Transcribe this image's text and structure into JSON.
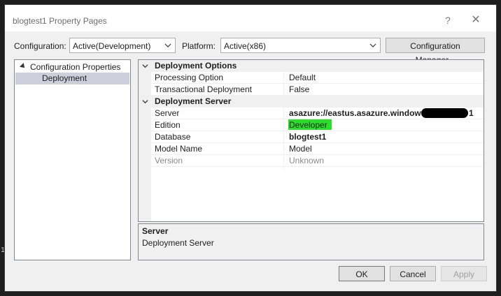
{
  "side_marker": "1",
  "window": {
    "title": "blogtest1 Property Pages",
    "help_glyph": "?",
    "close_glyph": "✕"
  },
  "toolbar": {
    "configuration_label": "Configuration:",
    "configuration_value": "Active(Development)",
    "platform_label": "Platform:",
    "platform_value": "Active(x86)",
    "config_manager_label": "Configuration Manager..."
  },
  "tree": {
    "root_label": "Configuration Properties",
    "child_label": "Deployment"
  },
  "grid": {
    "categories": [
      {
        "label": "Deployment Options",
        "properties": [
          {
            "name": "Processing Option",
            "value": "Default"
          },
          {
            "name": "Transactional Deployment",
            "value": "False"
          }
        ]
      },
      {
        "label": "Deployment Server",
        "properties": [
          {
            "name": "Server",
            "value": "asazure://eastus.asazure.windows.ne",
            "value_tail": "1"
          },
          {
            "name": "Edition",
            "value": "Developer"
          },
          {
            "name": "Database",
            "value": "blogtest1"
          },
          {
            "name": "Model Name",
            "value": "Model"
          },
          {
            "name": "Version",
            "value": "Unknown"
          }
        ]
      }
    ]
  },
  "description": {
    "title": "Server",
    "text": "Deployment Server"
  },
  "buttons": {
    "ok": "OK",
    "cancel": "Cancel",
    "apply": "Apply"
  },
  "colors": {
    "edition_highlight": "#28e028",
    "selection": "#cccedb"
  }
}
